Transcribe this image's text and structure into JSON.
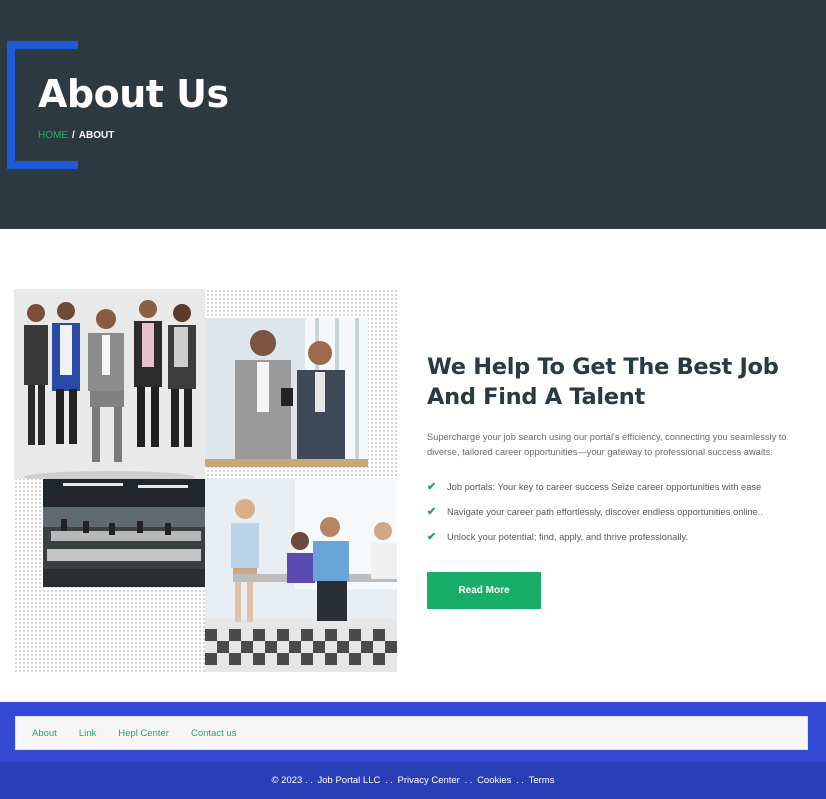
{
  "hero": {
    "title": "About Us",
    "breadcrumb": {
      "home": "HOME",
      "separator": "/",
      "current": "ABOUT"
    }
  },
  "about": {
    "heading_line1": "We Help To Get The Best Job",
    "heading_line2": "And Find A Talent",
    "description": "Supercharge your job search using our portal's efficiency, connecting you seamlessly to diverse, tailored career opportunities—your gateway to professional success awaits.",
    "checklist": [
      "Job portals: Your key to career success Seize career opportunities with ease",
      "Navigate your career path effortlessly, discover endless opportunities online..",
      "Unlock your potential; find, apply, and thrive professionally."
    ],
    "button_label": "Read More"
  },
  "footer": {
    "nav": [
      "About",
      "Link",
      "Hepl Center",
      "Contact us"
    ],
    "copyright": "© 2023 . .",
    "company": "Job Portal LLC",
    "sep1": ". .",
    "privacy": "Privacy Center",
    "sep2": ". .",
    "cookies": "Cookies",
    "sep3": ". .",
    "terms": "Terms"
  },
  "colors": {
    "hero_bg": "#2c3940",
    "accent_blue": "#1e59d6",
    "accent_green": "#19ad6a",
    "footer_blue": "#3448d6",
    "footer_dark_blue": "#2a3fb5"
  }
}
